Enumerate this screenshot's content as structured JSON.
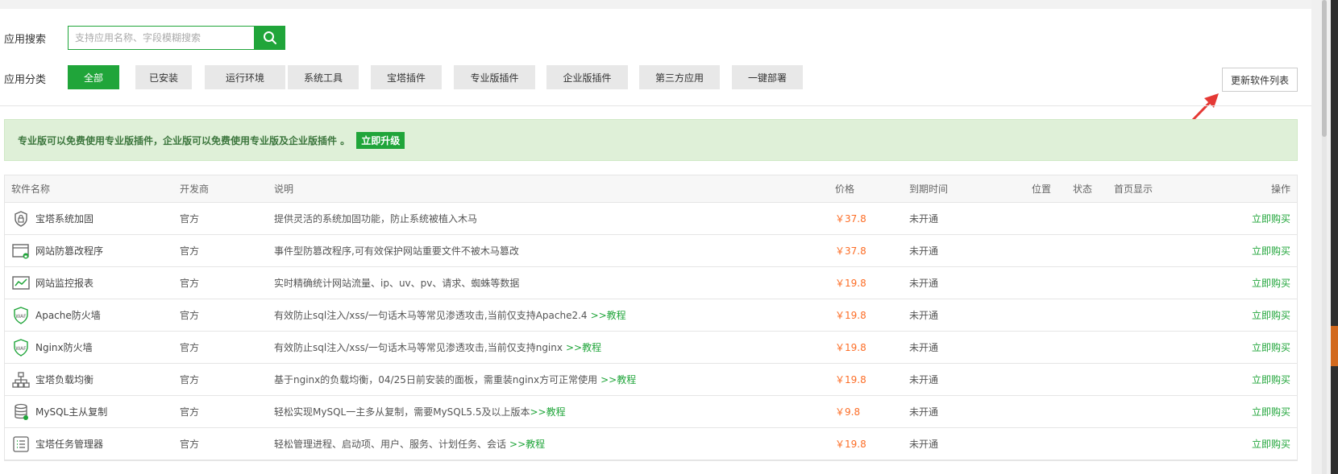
{
  "search": {
    "label": "应用搜索",
    "placeholder": "支持应用名称、字段模糊搜索"
  },
  "categories": {
    "label": "应用分类",
    "items": [
      "全部",
      "已安装",
      "运行环境",
      "系统工具",
      "宝塔插件",
      "专业版插件",
      "企业版插件",
      "第三方应用",
      "一键部署"
    ]
  },
  "update_button": "更新软件列表",
  "notice": {
    "text": "专业版可以免费使用专业版插件，企业版可以免费使用专业版及企业版插件 。",
    "upgrade": "立即升级"
  },
  "table": {
    "headers": {
      "name": "软件名称",
      "developer": "开发商",
      "description": "说明",
      "price": "价格",
      "expire": "到期时间",
      "position": "位置",
      "status": "状态",
      "homepage": "首页显示",
      "action": "操作"
    },
    "rows": [
      {
        "name": "宝塔系统加固",
        "icon": "lock-shield-icon",
        "developer": "官方",
        "description": "提供灵活的系统加固功能，防止系统被植入木马",
        "link": "",
        "price": "￥37.8",
        "expire": "未开通",
        "action": "立即购买"
      },
      {
        "name": "网站防篡改程序",
        "icon": "browser-lock-icon",
        "developer": "官方",
        "description": "事件型防篡改程序,可有效保护网站重要文件不被木马篡改",
        "link": "",
        "price": "￥37.8",
        "expire": "未开通",
        "action": "立即购买"
      },
      {
        "name": "网站监控报表",
        "icon": "chart-monitor-icon",
        "developer": "官方",
        "description": "实时精确统计网站流量、ip、uv、pv、请求、蜘蛛等数据",
        "link": "",
        "price": "￥19.8",
        "expire": "未开通",
        "action": "立即购买"
      },
      {
        "name": "Apache防火墙",
        "icon": "waf-shield-icon",
        "developer": "官方",
        "description": "有效防止sql注入/xss/一句话木马等常见渗透攻击,当前仅支持Apache2.4",
        "link": ">>教程",
        "price": "￥19.8",
        "expire": "未开通",
        "action": "立即购买"
      },
      {
        "name": "Nginx防火墙",
        "icon": "waf-shield-icon",
        "developer": "官方",
        "description": "有效防止sql注入/xss/一句话木马等常见渗透攻击,当前仅支持nginx",
        "link": ">>教程",
        "price": "￥19.8",
        "expire": "未开通",
        "action": "立即购买"
      },
      {
        "name": "宝塔负载均衡",
        "icon": "network-tree-icon",
        "developer": "官方",
        "description": "基于nginx的负载均衡，04/25日前安装的面板，需重装nginx方可正常使用",
        "link": ">>教程",
        "price": "￥19.8",
        "expire": "未开通",
        "action": "立即购买"
      },
      {
        "name": "MySQL主从复制",
        "icon": "database-icon",
        "developer": "官方",
        "description": "轻松实现MySQL一主多从复制，需要MySQL5.5及以上版本",
        "link": ">>教程",
        "price": "￥9.8",
        "expire": "未开通",
        "action": "立即购买"
      },
      {
        "name": "宝塔任务管理器",
        "icon": "task-list-icon",
        "developer": "官方",
        "description": "轻松管理进程、启动项、用户、服务、计划任务、会话",
        "link": ">>教程",
        "price": "￥19.8",
        "expire": "未开通",
        "action": "立即购买"
      }
    ]
  },
  "colors": {
    "accent": "#20a53a",
    "price": "#fc6d26",
    "notice_bg": "#dff0d8",
    "arrow": "#e53935"
  }
}
